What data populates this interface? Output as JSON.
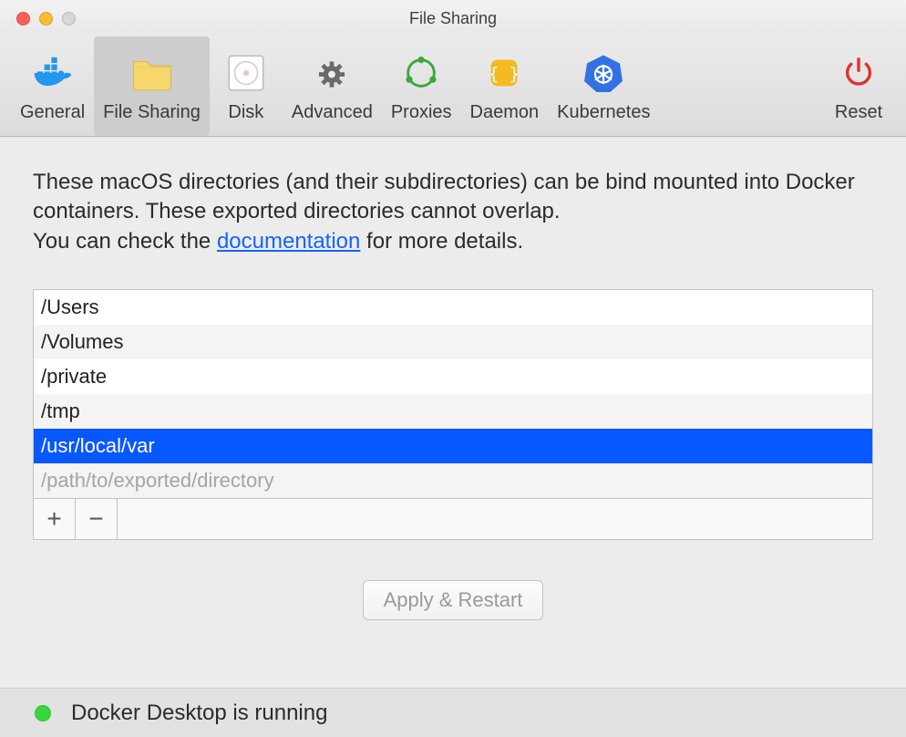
{
  "window": {
    "title": "File Sharing"
  },
  "tabs": [
    {
      "label": "General"
    },
    {
      "label": "File Sharing"
    },
    {
      "label": "Disk"
    },
    {
      "label": "Advanced"
    },
    {
      "label": "Proxies"
    },
    {
      "label": "Daemon"
    },
    {
      "label": "Kubernetes"
    }
  ],
  "reset": {
    "label": "Reset"
  },
  "description": {
    "line1": "These macOS directories (and their subdirectories) can be bind mounted into Docker containers. These exported directories cannot overlap.",
    "line2a": "You can check the ",
    "link": "documentation",
    "line2b": " for more details."
  },
  "paths": [
    "/Users",
    "/Volumes",
    "/private",
    "/tmp",
    "/usr/local/var"
  ],
  "new_path_placeholder": "/path/to/exported/directory",
  "buttons": {
    "apply": "Apply & Restart",
    "plus": "+",
    "minus": "−"
  },
  "status": {
    "text": "Docker Desktop is running"
  }
}
